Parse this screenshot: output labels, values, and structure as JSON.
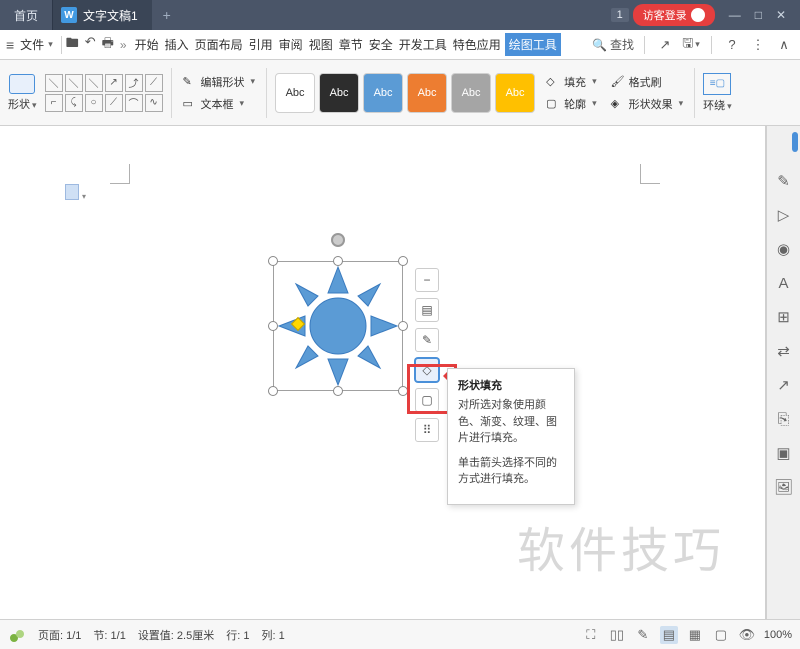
{
  "titlebar": {
    "home_tab": "首页",
    "doc_tab": "文字文稿1",
    "doc_icon": "W",
    "new_tab": "+",
    "badge": "1",
    "login": "访客登录",
    "win_min": "—",
    "win_max": "□",
    "win_close": "✕"
  },
  "menubar": {
    "file": "文件",
    "qat_save": "🖿",
    "qat_undo": "↶",
    "qat_print": "🖶",
    "more": "»",
    "items": [
      "开始",
      "插入",
      "页面布局",
      "引用",
      "审阅",
      "视图",
      "章节",
      "安全",
      "开发工具",
      "特色应用",
      "绘图工具"
    ],
    "active_index": 10,
    "search_icon": "🔍",
    "search_text": "查找",
    "share_icon": "↗",
    "save_icon": "🖫",
    "help_icon": "?",
    "more_icon": "⋮",
    "collapse_icon": "∧"
  },
  "ribbon": {
    "shape_label": "形状",
    "edit_shape": "编辑形状",
    "textbox": "文本框",
    "style_text": "Abc",
    "fill": "填充",
    "format_painter": "格式刷",
    "outline": "轮廓",
    "shape_effects": "形状效果",
    "wrap": "环绕"
  },
  "float_toolbar": {
    "btn_collapse": "−",
    "btn_layout": "▤",
    "btn_eyedropper": "✎",
    "btn_fill": "◇",
    "btn_outline": "▢",
    "btn_more": "⠿"
  },
  "tooltip": {
    "title": "形状填充",
    "body1": "对所选对象使用颜色、渐变、纹理、图片进行填充。",
    "body2": "单击箭头选择不同的方式进行填充。"
  },
  "sidebar_icons": [
    "✎",
    "▷",
    "◉",
    "A",
    "⊞",
    "⇄",
    "↗",
    "⎘",
    "▣",
    "🖼"
  ],
  "statusbar": {
    "page": "页面: 1/1",
    "section": "节: 1/1",
    "setting": "设置值: 2.5厘米",
    "row": "行: 1",
    "col": "列: 1",
    "zoom": "100%",
    "view_icons": [
      "⛶",
      "▯▯",
      "✎",
      "▤",
      "▦",
      "▢",
      "👁"
    ]
  },
  "watermark": "软件技巧"
}
